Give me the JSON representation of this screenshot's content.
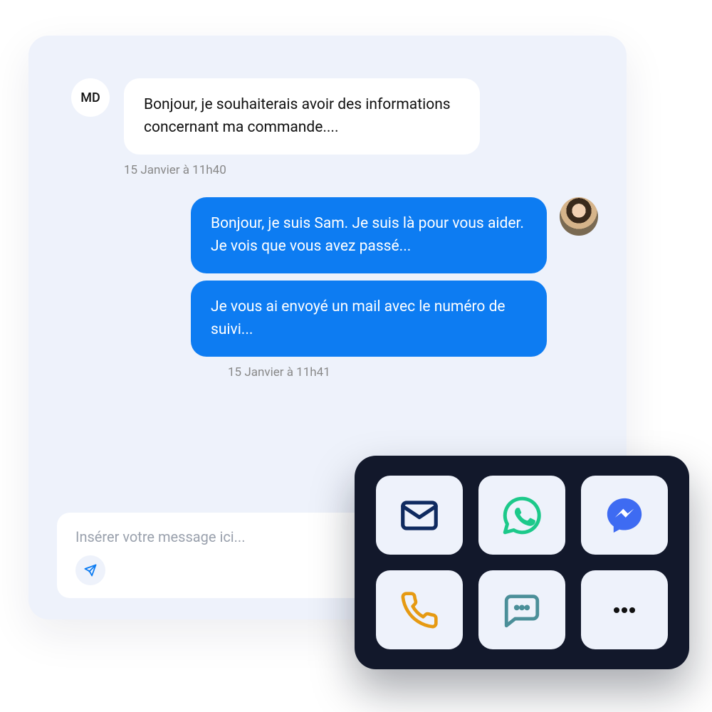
{
  "chat": {
    "customer": {
      "initials": "MD",
      "message": "Bonjour, je souhaiterais avoir des informations concernant ma commande....",
      "timestamp": "15 Janvier à 11h40"
    },
    "agent": {
      "messages": [
        "Bonjour, je suis Sam. Je suis là pour vous aider. Je vois que vous avez passé...",
        "Je vous ai envoyé un mail avec le numéro de suivi..."
      ],
      "timestamp": "15 Janvier à 11h41"
    }
  },
  "composer": {
    "placeholder": "Insérer votre message ici..."
  },
  "channels": [
    {
      "name": "email"
    },
    {
      "name": "whatsapp"
    },
    {
      "name": "messenger"
    },
    {
      "name": "phone"
    },
    {
      "name": "sms"
    },
    {
      "name": "more"
    }
  ],
  "colors": {
    "panel_bg": "#EEF2FB",
    "bubble_blue": "#0D7CF2",
    "dark_panel": "#12182B",
    "email_icon": "#0F2A5F",
    "whatsapp_icon": "#1CC98A",
    "messenger_icon": "#3E6BF2",
    "phone_icon": "#E69A12",
    "sms_icon": "#4B8F99"
  }
}
